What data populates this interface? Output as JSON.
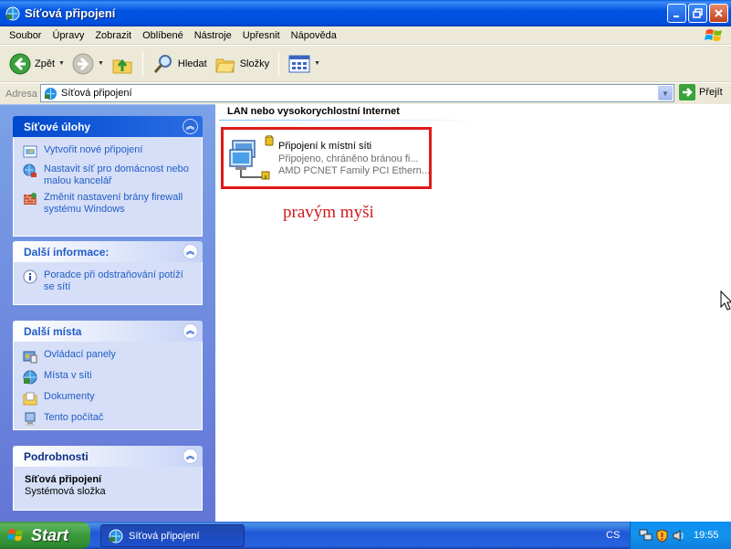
{
  "window": {
    "title": "Síťová připojení"
  },
  "menu": {
    "items": [
      "Soubor",
      "Úpravy",
      "Zobrazit",
      "Oblíbené",
      "Nástroje",
      "Upřesnit",
      "Nápověda"
    ]
  },
  "toolbar": {
    "back_label": "Zpět",
    "search_label": "Hledat",
    "folders_label": "Složky"
  },
  "address": {
    "label": "Adresa",
    "value": "Síťová připojení",
    "go_label": "Přejít"
  },
  "taskpane": {
    "network_tasks": {
      "title": "Síťové úlohy",
      "items": [
        {
          "label": "Vytvořit nové připojení",
          "icon": "new-connection-icon"
        },
        {
          "label": "Nastavit síť pro domácnost nebo malou kancelář",
          "icon": "home-network-icon"
        },
        {
          "label": "Změnit nastavení brány firewall systému Windows",
          "icon": "firewall-icon"
        }
      ]
    },
    "more_info": {
      "title": "Další informace:",
      "items": [
        {
          "label": "Poradce při odstraňování potíží se sítí",
          "icon": "info-icon"
        }
      ]
    },
    "other_places": {
      "title": "Další místa",
      "items": [
        {
          "label": "Ovládací panely",
          "icon": "control-panel-icon"
        },
        {
          "label": "Místa v síti",
          "icon": "network-places-icon"
        },
        {
          "label": "Dokumenty",
          "icon": "documents-icon"
        },
        {
          "label": "Tento počítač",
          "icon": "my-computer-icon"
        }
      ]
    },
    "details": {
      "title": "Podrobnosti",
      "name": "Síťová připojení",
      "type": "Systémová složka"
    }
  },
  "content": {
    "group_title": "LAN nebo vysokorychlostní Internet",
    "connection": {
      "name": "Připojení k místní síti",
      "status": "Připojeno, chráněno bránou fi...",
      "device": "AMD PCNET Family PCI Ethern..."
    },
    "annotation": "pravým myši"
  },
  "taskbar": {
    "start_label": "Start",
    "active_window": "Síťová připojení",
    "language": "CS",
    "clock": "19:55"
  },
  "colors": {
    "titlebar": "#0054e3",
    "taskpane_bg": "#6f8fdd",
    "link": "#215dc6",
    "annotation": "#d11a1a",
    "highlight_border": "#e01a1a"
  }
}
